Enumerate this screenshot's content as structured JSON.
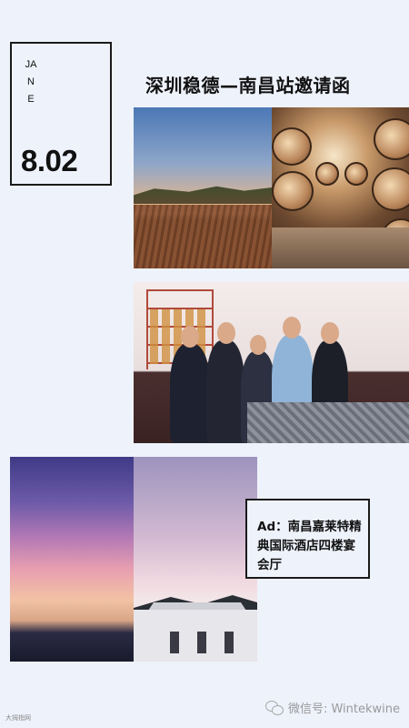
{
  "header": {
    "month_vertical": "JANE",
    "date": "8.02",
    "title": "深圳稳德—南昌站邀请函"
  },
  "ad": {
    "text": "Ad：南昌嘉莱特精典国际酒店四楼宴会厅"
  },
  "footer": {
    "wechat_label": "微信号: Wintekwine",
    "left_mark": "大拇指网"
  },
  "icons": [
    "wechat-icon"
  ]
}
